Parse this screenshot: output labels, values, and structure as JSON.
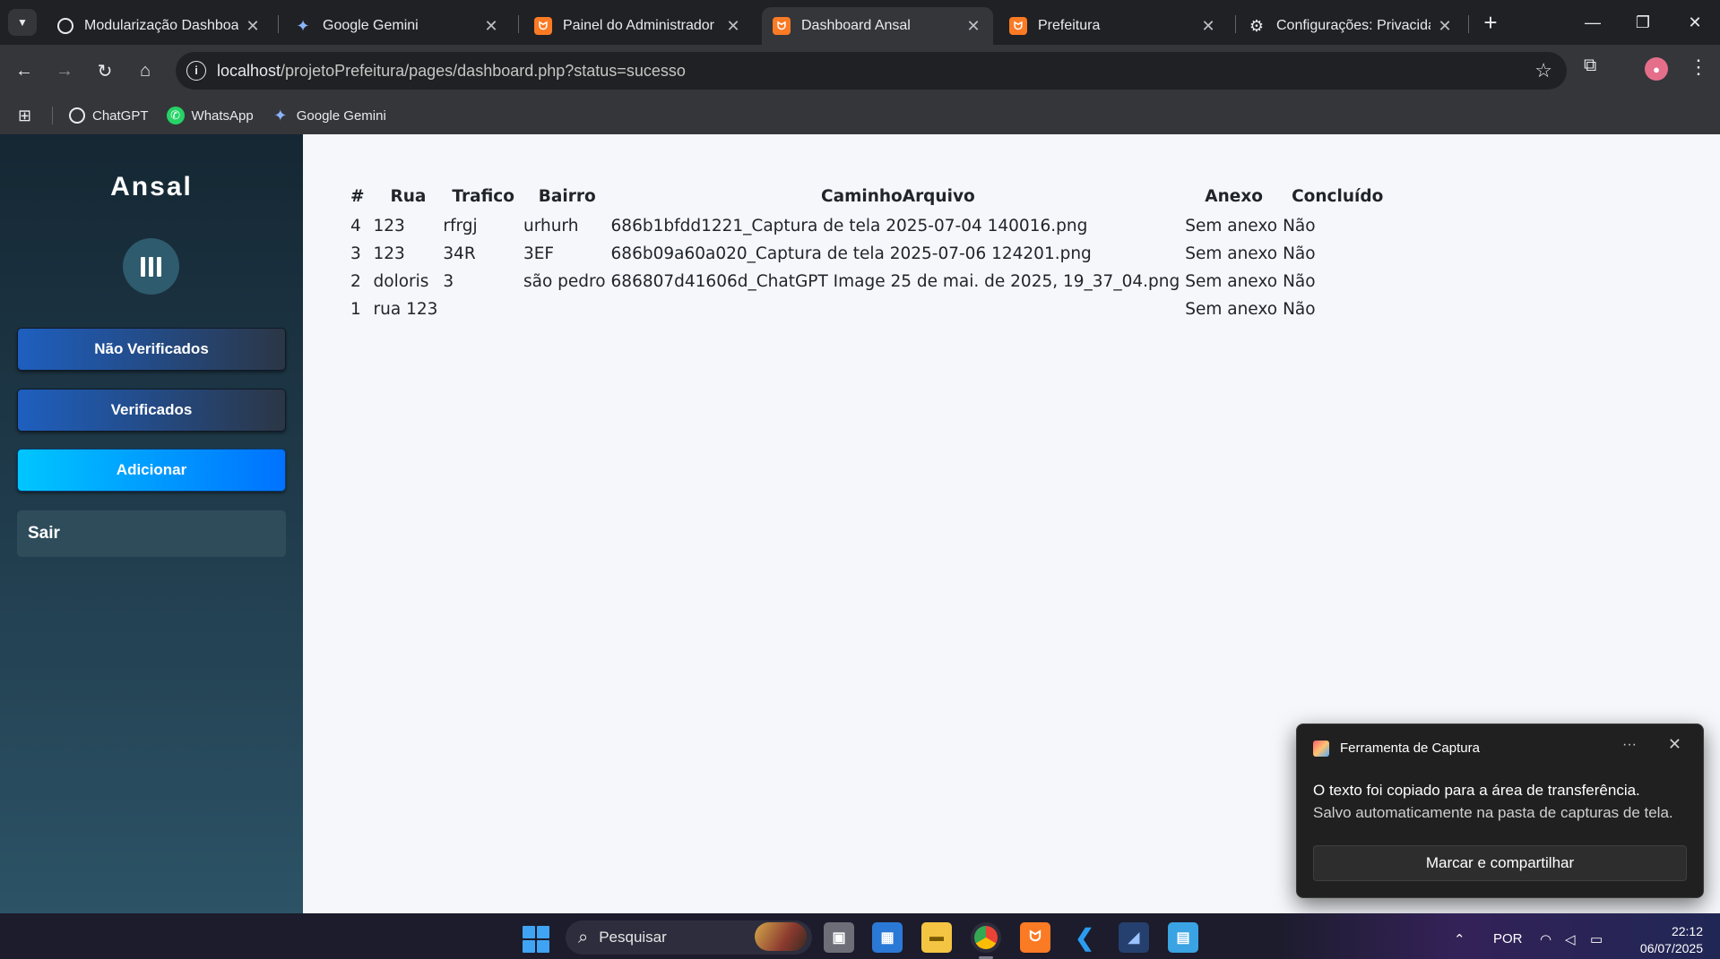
{
  "browser": {
    "tabs": [
      {
        "title": "Modularização Dashboard",
        "icon": "github-icon"
      },
      {
        "title": "Google Gemini",
        "icon": "gemini-icon"
      },
      {
        "title": "Painel do Administrador",
        "icon": "xampp-icon"
      },
      {
        "title": "Dashboard Ansal",
        "icon": "xampp-icon",
        "active": true
      },
      {
        "title": "Prefeitura",
        "icon": "xampp-icon"
      },
      {
        "title": "Configurações: Privacidade",
        "icon": "gear-icon"
      }
    ],
    "url_host": "localhost",
    "url_path": "/projetoPrefeitura/pages/dashboard.php?status=sucesso",
    "bookmarks": [
      {
        "label": "ChatGPT",
        "icon": "chatgpt-icon"
      },
      {
        "label": "WhatsApp",
        "icon": "whatsapp-icon"
      },
      {
        "label": "Google Gemini",
        "icon": "gemini-icon"
      }
    ]
  },
  "sidebar": {
    "brand": "Ansal",
    "buttons": {
      "nao_verificados": "Não Verificados",
      "verificados": "Verificados",
      "adicionar": "Adicionar",
      "sair": "Sair"
    }
  },
  "table": {
    "headers": [
      "#",
      "Rua",
      "Trafico",
      "Bairro",
      "CaminhoArquivo",
      "Anexo",
      "Concluído"
    ],
    "rows": [
      [
        "4",
        "123",
        "rfrgj",
        "urhurh",
        "686b1bfdd1221_Captura de tela 2025-07-04 140016.png",
        "Sem anexo",
        "Não"
      ],
      [
        "3",
        "123",
        "34R",
        "3EF",
        "686b09a60a020_Captura de tela 2025-07-06 124201.png",
        "Sem anexo",
        "Não"
      ],
      [
        "2",
        "doloris",
        "3",
        "são pedro",
        "686807d41606d_ChatGPT Image 25 de mai. de 2025, 19_37_04.png",
        "Sem anexo",
        "Não"
      ],
      [
        "1",
        "rua 123",
        "",
        "",
        "",
        "Sem anexo",
        "Não"
      ]
    ]
  },
  "toast": {
    "app": "Ferramenta de Captura",
    "line1": "O texto foi copiado para a área de transferência.",
    "line2": "Salvo automaticamente na pasta de capturas de tela.",
    "button": "Marcar e compartilhar"
  },
  "taskbar": {
    "search_placeholder": "Pesquisar",
    "language": "POR",
    "time": "22:12",
    "date": "06/07/2025"
  },
  "colors": {
    "sidebar_top": "#152733",
    "sidebar_bottom": "#2c5366",
    "add_button": "#00c6ff",
    "content_bg": "#f5f7fb"
  }
}
